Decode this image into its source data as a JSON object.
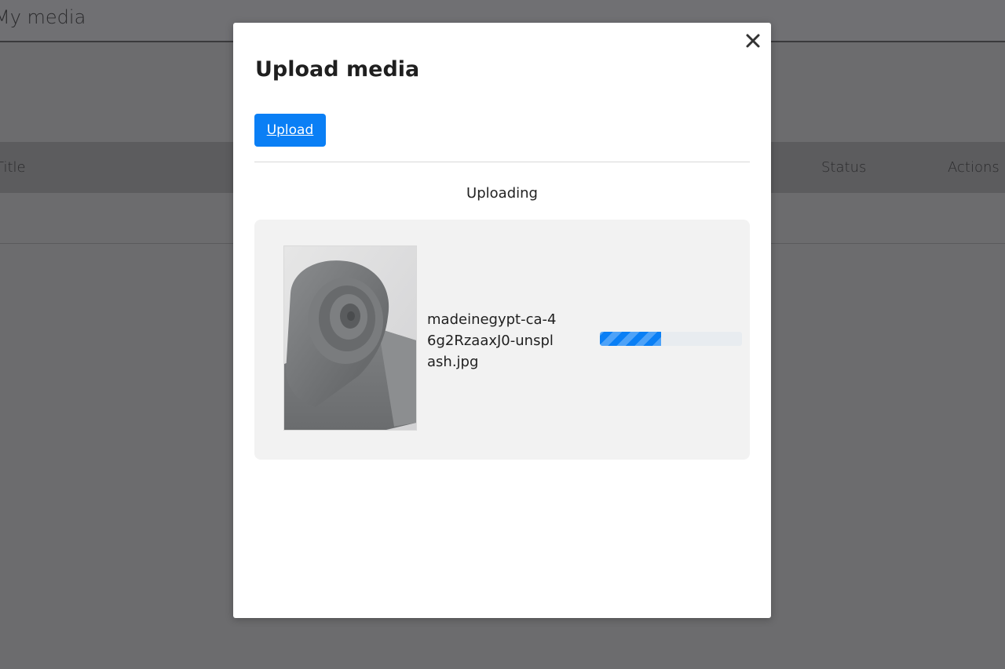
{
  "page": {
    "title": "My media",
    "table": {
      "columns": [
        "Title",
        "Status",
        "Actions"
      ]
    }
  },
  "modal": {
    "title": "Upload media",
    "close_icon": "close-icon",
    "upload_button": "Upload",
    "status_text": "Uploading",
    "file": {
      "name": "madeinegypt-ca-46g2RzaaxJ0-unsplash.jpg",
      "thumbnail": "rolled-grey-towel",
      "progress_percent": 43
    }
  },
  "colors": {
    "accent": "#0a7ff5",
    "overlay": "#6c6c6e",
    "card_bg": "#f2f2f2"
  }
}
